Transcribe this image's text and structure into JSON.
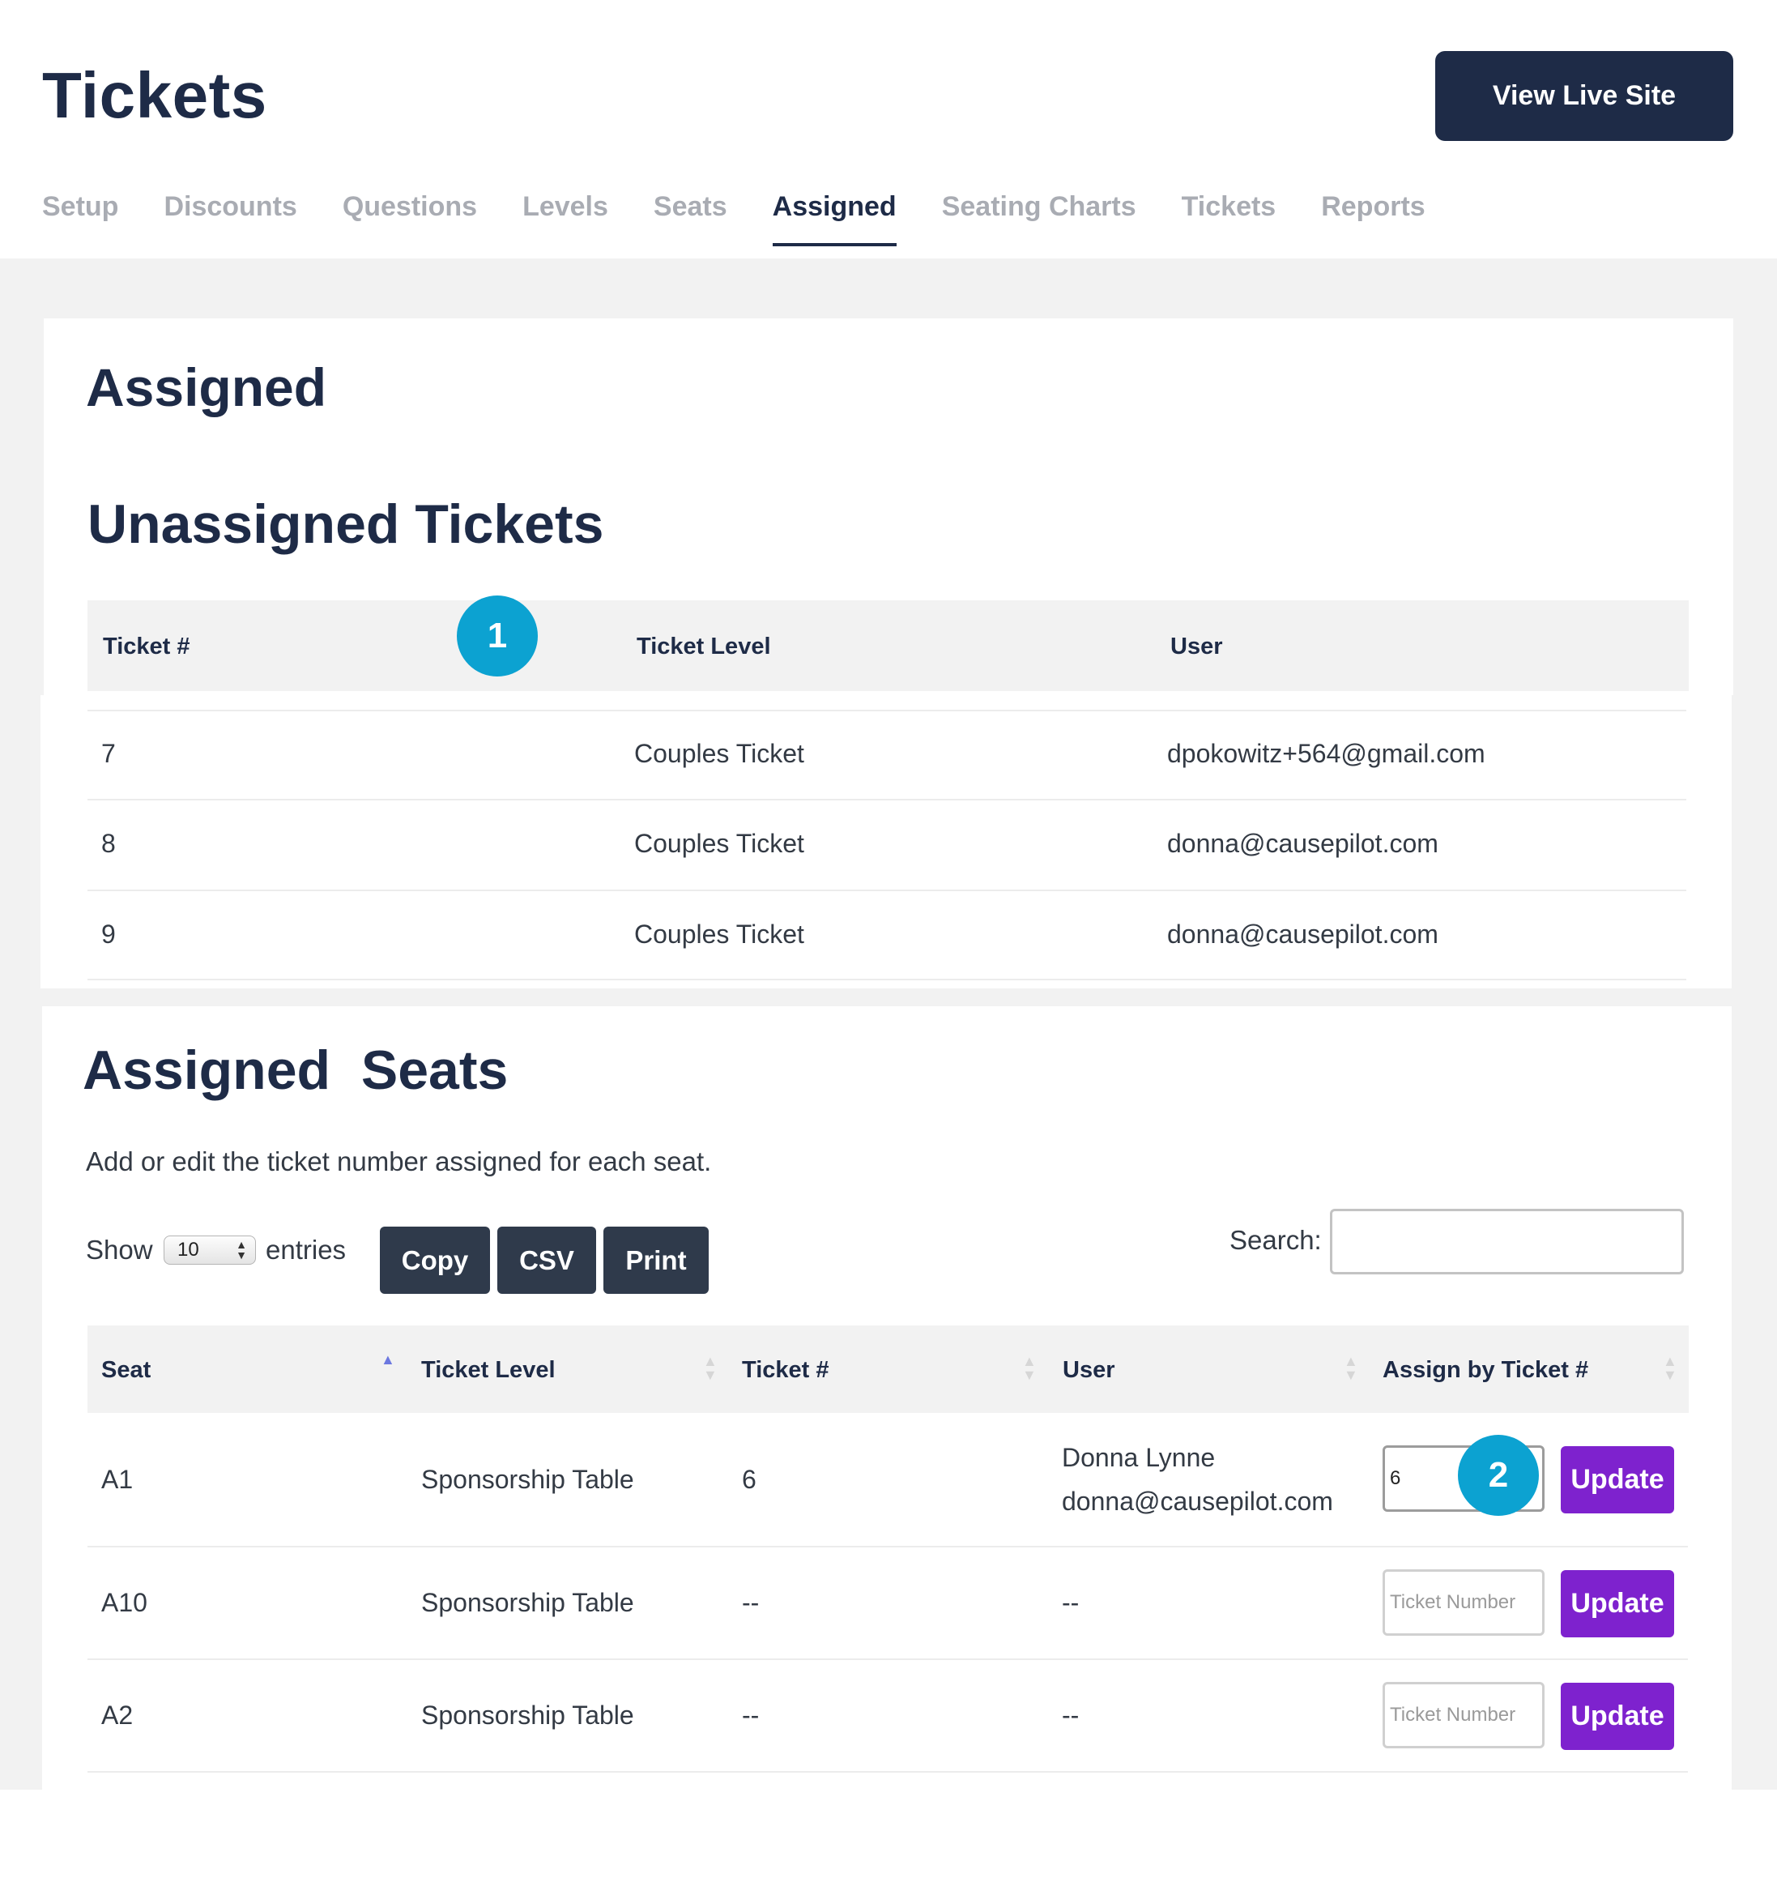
{
  "header": {
    "title": "Tickets",
    "view_live_label": "View Live Site"
  },
  "tabs": [
    {
      "label": "Setup",
      "active": false
    },
    {
      "label": "Discounts",
      "active": false
    },
    {
      "label": "Questions",
      "active": false
    },
    {
      "label": "Levels",
      "active": false
    },
    {
      "label": "Seats",
      "active": false
    },
    {
      "label": "Assigned",
      "active": true
    },
    {
      "label": "Seating Charts",
      "active": false
    },
    {
      "label": "Tickets",
      "active": false
    },
    {
      "label": "Reports",
      "active": false
    }
  ],
  "assigned_section": {
    "title": "Assigned"
  },
  "unassigned": {
    "title": "Unassigned Tickets",
    "columns": [
      "Ticket #",
      "Ticket Level",
      "User"
    ],
    "badge": "1",
    "rows": [
      {
        "ticket": "7",
        "level": "Couples Ticket",
        "user": "dpokowitz+564@gmail.com"
      },
      {
        "ticket": "8",
        "level": "Couples Ticket",
        "user": "donna@causepilot.com"
      },
      {
        "ticket": "9",
        "level": "Couples Ticket",
        "user": "donna@causepilot.com"
      }
    ]
  },
  "assigned_seats": {
    "title": "Assigned  Seats",
    "description": "Add or edit the ticket number assigned for each seat.",
    "show_label": "Show",
    "entries_value": "10",
    "entries_label": "entries",
    "buttons": {
      "copy": "Copy",
      "csv": "CSV",
      "print": "Print"
    },
    "search_label": "Search:",
    "columns": [
      "Seat",
      "Ticket Level",
      "Ticket #",
      "User",
      "Assign by Ticket #"
    ],
    "badge": "2",
    "ticket_placeholder": "Ticket Number",
    "update_label": "Update",
    "rows": [
      {
        "seat": "A1",
        "level": "Sponsorship Table",
        "ticket": "6",
        "user_name": "Donna Lynne",
        "user_email": "donna@causepilot.com",
        "input_value": "6"
      },
      {
        "seat": "A10",
        "level": "Sponsorship Table",
        "ticket": "--",
        "user_name": "--",
        "user_email": "",
        "input_value": ""
      },
      {
        "seat": "A2",
        "level": "Sponsorship Table",
        "ticket": "--",
        "user_name": "--",
        "user_email": "",
        "input_value": ""
      }
    ]
  },
  "colors": {
    "navy": "#1e2b47",
    "badge": "#0ca2d1",
    "update": "#7e22ce",
    "dt_button": "#2f3a4b"
  }
}
